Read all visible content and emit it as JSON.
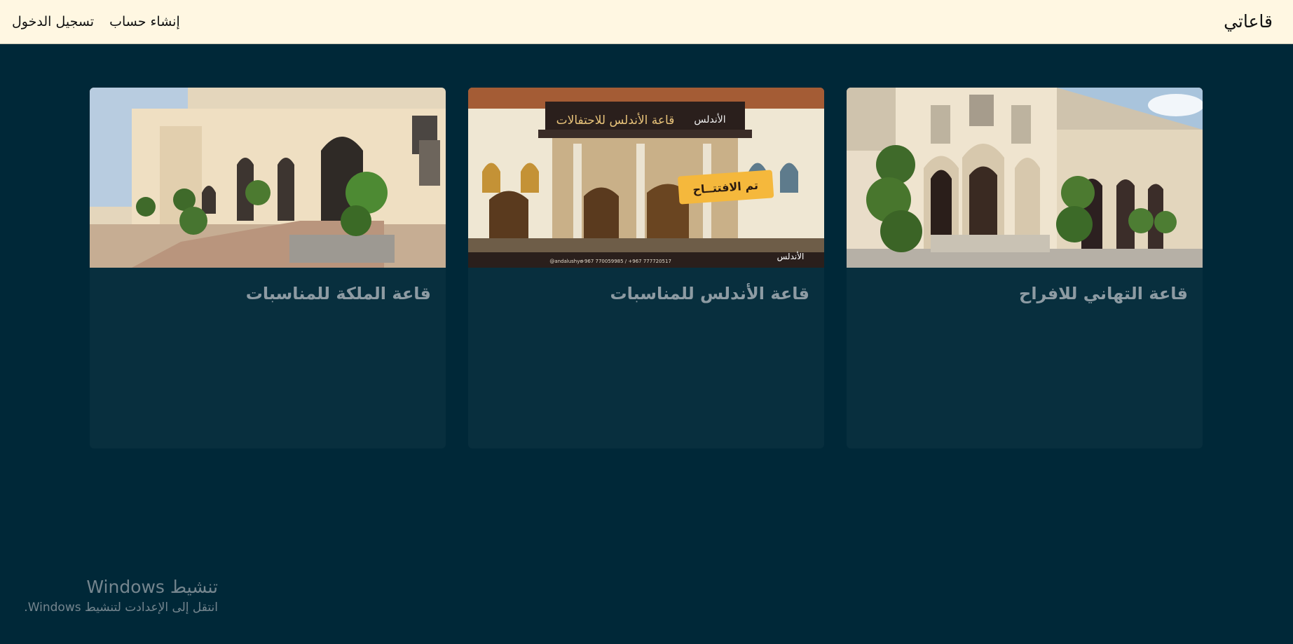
{
  "navbar": {
    "brand": "قاعاتي",
    "links": [
      {
        "label": "تسجيل الدخول"
      },
      {
        "label": "إنشاء حساب"
      }
    ]
  },
  "halls": [
    {
      "title": "قاعة التهاني للافراح"
    },
    {
      "title": "قاعة الأندلس للمناسبات",
      "image_text": {
        "sign": "قاعة الأندلس للاحتفالات",
        "badge": "تم الافتتــاح",
        "logo": "الأندلس",
        "phones": "+967 770059985 / +967 777720517",
        "social": "@andalushye"
      }
    },
    {
      "title": "قاعة الملكة للمناسبات"
    }
  ],
  "activation": {
    "title": "تنشيط Windows",
    "subtitle": "انتقل إلى الإعدادت لتنشيط Windows."
  },
  "colors": {
    "page_bg": "#002838",
    "navbar_bg": "#fff7e2",
    "card_bg": "#082f3e",
    "card_title": "#8d9ba3",
    "badge": "#f5b83c"
  }
}
